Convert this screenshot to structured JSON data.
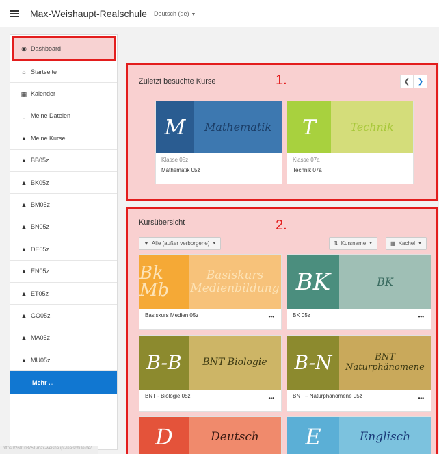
{
  "header": {
    "site_name": "Max-Weishaupt-Realschule",
    "language": "Deutsch (de)"
  },
  "sidebar": {
    "items": [
      {
        "label": "Dashboard",
        "icon": "dashboard-icon"
      },
      {
        "label": "Startseite",
        "icon": "home-icon"
      },
      {
        "label": "Kalender",
        "icon": "calendar-icon"
      },
      {
        "label": "Meine Dateien",
        "icon": "file-icon"
      },
      {
        "label": "Meine Kurse",
        "icon": "graduation-cap-icon"
      },
      {
        "label": "BB05z",
        "icon": "graduation-cap-icon"
      },
      {
        "label": "BK05z",
        "icon": "graduation-cap-icon"
      },
      {
        "label": "BM05z",
        "icon": "graduation-cap-icon"
      },
      {
        "label": "BN05z",
        "icon": "graduation-cap-icon"
      },
      {
        "label": "DE05z",
        "icon": "graduation-cap-icon"
      },
      {
        "label": "EN05z",
        "icon": "graduation-cap-icon"
      },
      {
        "label": "ET05z",
        "icon": "graduation-cap-icon"
      },
      {
        "label": "GO05z",
        "icon": "graduation-cap-icon"
      },
      {
        "label": "MA05z",
        "icon": "graduation-cap-icon"
      },
      {
        "label": "MU05z",
        "icon": "graduation-cap-icon"
      }
    ],
    "more_label": "Mehr ..."
  },
  "recent": {
    "title": "Zuletzt besuchte Kurse",
    "annotation": "1.",
    "courses": [
      {
        "letter": "M",
        "word": "Mathematik",
        "category": "Klasse 05z",
        "name": "Mathematik 05z",
        "left_color": "#2a5c91",
        "right_color": "#3d78b0",
        "text_color": "#1b3d66"
      },
      {
        "letter": "T",
        "word": "Technik",
        "category": "Klasse 07a",
        "name": "Technik 07a",
        "left_color": "#a8d13e",
        "right_color": "#d4dd7a",
        "text_color": "#a8c83a"
      }
    ]
  },
  "overview": {
    "title": "Kursübersicht",
    "annotation": "2.",
    "filter_label": "Alle (außer verborgene)",
    "sort_label": "Kursname",
    "view_label": "Kachel",
    "courses": [
      {
        "letter": "Bk Mb",
        "word": "Basiskurs Medienbildung",
        "name": "Basiskurs Medien 05z",
        "left_color": "#f5a936",
        "right_color": "#f7c27a",
        "text_color": "#fde3b6"
      },
      {
        "letter": "BK",
        "word": "BK",
        "name": "BK 05z",
        "left_color": "#4b8e7e",
        "right_color": "#9fbfb5",
        "text_color": "#3a6b60"
      },
      {
        "letter": "B-B",
        "word": "BNT Biologie",
        "name": "BNT - Biologie 05z",
        "left_color": "#8c8a2e",
        "right_color": "#cdb566",
        "text_color": "#3d3a13"
      },
      {
        "letter": "B-N",
        "word": "BNT Naturphänomene",
        "name": "BNT – Naturphänomene 05z",
        "left_color": "#8c8a2e",
        "right_color": "#c9a95b",
        "text_color": "#3d3a13"
      },
      {
        "letter": "D",
        "word": "Deutsch",
        "name": "",
        "left_color": "#e4533a",
        "right_color": "#f08a6c",
        "text_color": "#3a1a12"
      },
      {
        "letter": "E",
        "word": "Englisch",
        "name": "",
        "left_color": "#5bafd6",
        "right_color": "#7cc2de",
        "text_color": "#1c3c7a"
      }
    ]
  },
  "status_url": "https://260108751-max-weishaupt-realschule.de/..."
}
